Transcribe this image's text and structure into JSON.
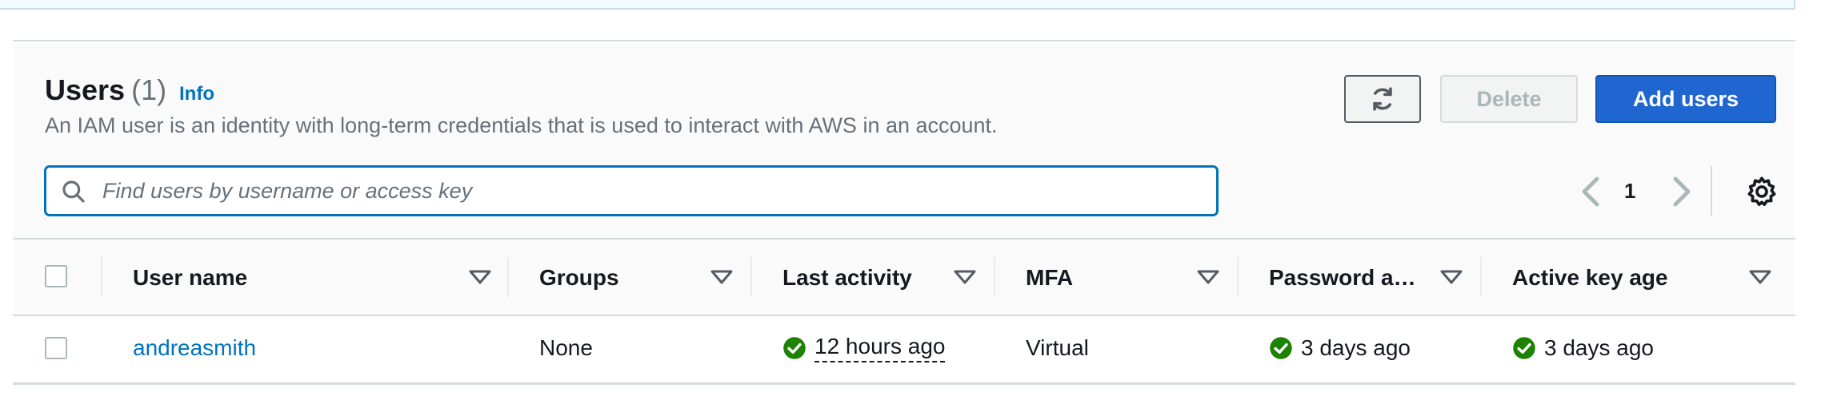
{
  "header": {
    "title": "Users",
    "count": "(1)",
    "info_label": "Info",
    "description": "An IAM user is an identity with long-term credentials that is used to interact with AWS in an account."
  },
  "actions": {
    "refresh_icon": "refresh-icon",
    "delete_label": "Delete",
    "add_label": "Add users"
  },
  "search": {
    "placeholder": "Find users by username or access key",
    "value": ""
  },
  "pagination": {
    "current_page": "1"
  },
  "table": {
    "columns": [
      {
        "label": "User name"
      },
      {
        "label": "Groups"
      },
      {
        "label": "Last activity"
      },
      {
        "label": "MFA"
      },
      {
        "label": "Password a…"
      },
      {
        "label": "Active key age"
      }
    ],
    "rows": [
      {
        "user_name": "andreasmith",
        "groups": "None",
        "last_activity": "12 hours ago",
        "mfa": "Virtual",
        "password_age": "3 days ago",
        "active_key_age": "3 days ago"
      }
    ]
  },
  "colors": {
    "primary": "#1f66d1",
    "link": "#0073bb",
    "success": "#1d8102",
    "muted": "#687078"
  }
}
